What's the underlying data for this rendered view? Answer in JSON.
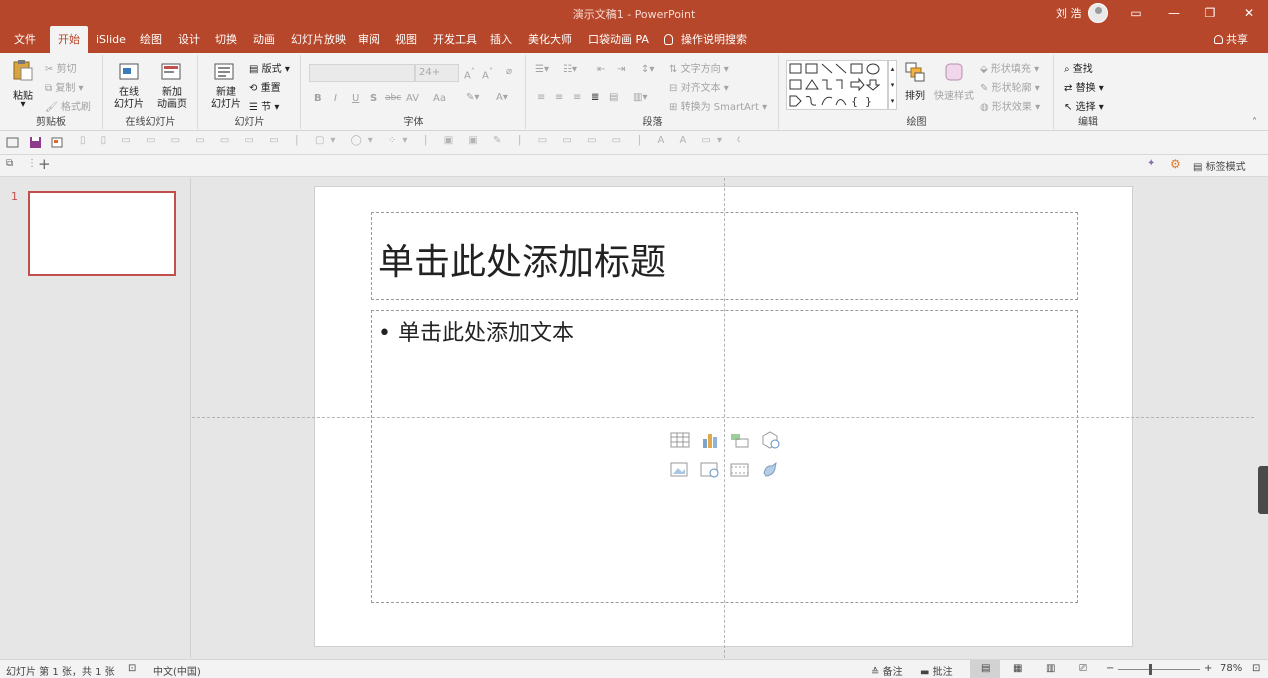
{
  "titlebar": {
    "title": "演示文稿1  -  PowerPoint",
    "user": "刘 浩",
    "btn_ribbon": "▭",
    "btn_min": "—",
    "btn_restore": "❐",
    "btn_close": "✕"
  },
  "tabs": [
    {
      "label": "文件"
    },
    {
      "label": "开始"
    },
    {
      "label": "iSlide"
    },
    {
      "label": "绘图"
    },
    {
      "label": "设计"
    },
    {
      "label": "切换"
    },
    {
      "label": "动画"
    },
    {
      "label": "幻灯片放映"
    },
    {
      "label": "审阅"
    },
    {
      "label": "视图"
    },
    {
      "label": "开发工具"
    },
    {
      "label": "插入"
    },
    {
      "label": "美化大师"
    },
    {
      "label": "口袋动画 PA"
    }
  ],
  "tellme": "操作说明搜索",
  "share": "共享",
  "ribbon": {
    "clipboard": {
      "paste": "粘贴",
      "cut": "剪切",
      "copy": "复制",
      "format_painter": "格式刷",
      "label": "剪贴板"
    },
    "online": {
      "online_slides": "在线\n幻灯片",
      "new_anim": "新加\n动画页",
      "label": "在线幻灯片"
    },
    "slides": {
      "new_slide": "新建\n幻灯片",
      "layout": "版式",
      "reset": "重置",
      "section": "节",
      "label": "幻灯片"
    },
    "font": {
      "size": "24+",
      "bold": "B",
      "italic": "I",
      "underline": "U",
      "shadow": "S",
      "strike": "abc",
      "spacing": "AV",
      "case": "Aa",
      "label": "字体"
    },
    "paragraph": {
      "text_direction": "文字方向",
      "align_text": "对齐文本",
      "smartart": "转换为 SmartArt",
      "label": "段落"
    },
    "drawing": {
      "arrange": "排列",
      "quick_styles": "快速样式",
      "fill": "形状填充",
      "outline": "形状轮廓",
      "effects": "形状效果",
      "label": "绘图"
    },
    "editing": {
      "find": "查找",
      "replace": "替换",
      "select": "选择",
      "label": "编辑"
    }
  },
  "addbar": {
    "tag_mode": "标签模式"
  },
  "thumbnail": {
    "number": "1"
  },
  "slide": {
    "title_placeholder": "单击此处添加标题",
    "body_placeholder": "• 单击此处添加文本"
  },
  "statusbar": {
    "slide_info": "幻灯片 第 1 张，共 1 张",
    "language": "中文(中国)",
    "notes": "备注",
    "comments": "批注",
    "zoom": "78%",
    "zoom_level": 0.78
  },
  "colors": {
    "accent": "#b7472a",
    "selection": "#c0504d"
  }
}
